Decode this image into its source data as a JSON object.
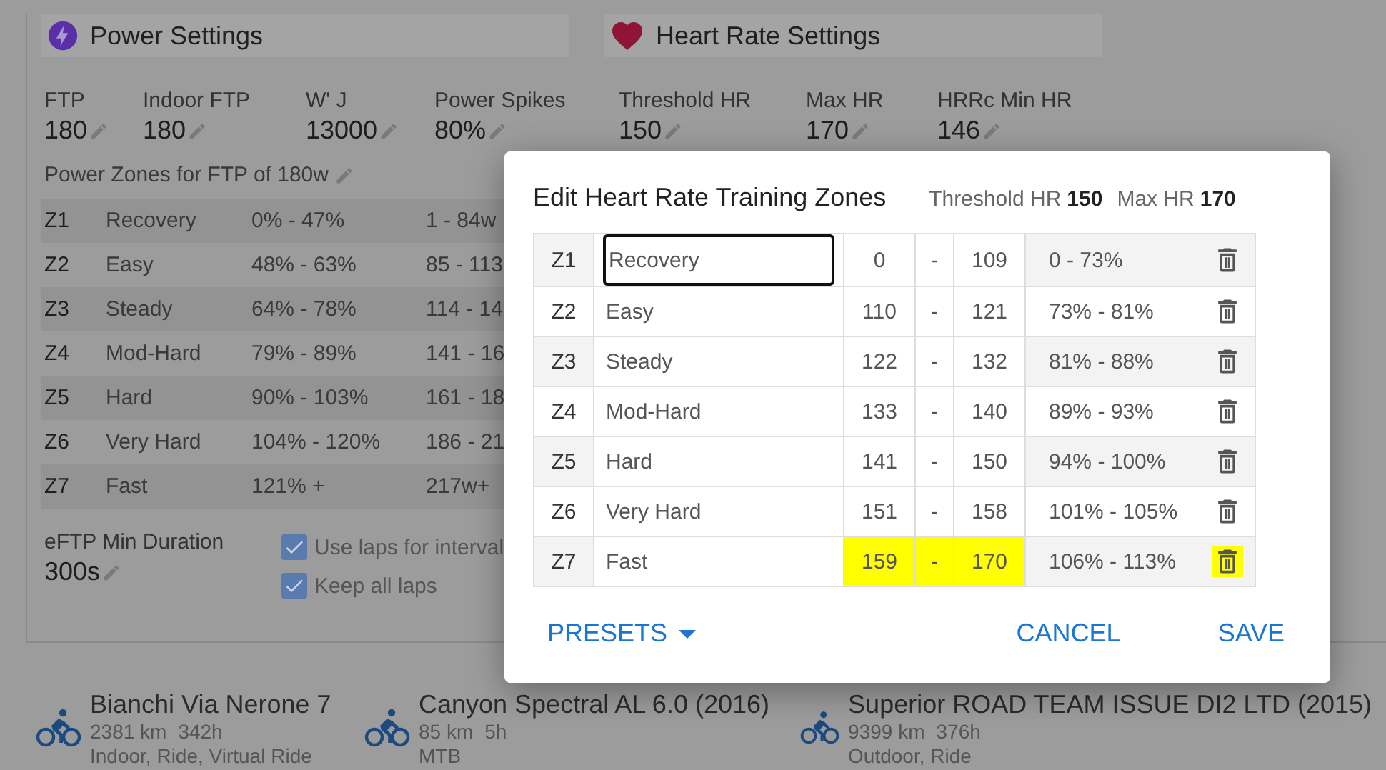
{
  "power_settings": {
    "title": "Power Settings",
    "fields": [
      {
        "label": "FTP",
        "value": "180"
      },
      {
        "label": "Indoor FTP",
        "value": "180"
      },
      {
        "label": "W' J",
        "value": "13000"
      },
      {
        "label": "Power Spikes",
        "value": "80%"
      }
    ],
    "zones_title": "Power Zones for FTP of 180w",
    "zones": [
      {
        "zone": "Z1",
        "name": "Recovery",
        "percent": "0% - 47%",
        "watts": "1 - 84w"
      },
      {
        "zone": "Z2",
        "name": "Easy",
        "percent": "48% - 63%",
        "watts": "85 - 113"
      },
      {
        "zone": "Z3",
        "name": "Steady",
        "percent": "64% - 78%",
        "watts": "114 - 14"
      },
      {
        "zone": "Z4",
        "name": "Mod-Hard",
        "percent": "79% - 89%",
        "watts": "141 - 16"
      },
      {
        "zone": "Z5",
        "name": "Hard",
        "percent": "90% - 103%",
        "watts": "161 - 18"
      },
      {
        "zone": "Z6",
        "name": "Very Hard",
        "percent": "104% - 120%",
        "watts": "186 - 21"
      },
      {
        "zone": "Z7",
        "name": "Fast",
        "percent": "121% +",
        "watts": "217w+"
      }
    ],
    "eftp": {
      "label": "eFTP Min Duration",
      "value": "300s"
    },
    "options": [
      {
        "label": "Use laps for interval",
        "checked": true
      },
      {
        "label": "Keep all laps",
        "checked": true
      }
    ]
  },
  "heart_rate_settings": {
    "title": "Heart Rate Settings",
    "fields": [
      {
        "label": "Threshold HR",
        "value": "150"
      },
      {
        "label": "Max HR",
        "value": "170"
      },
      {
        "label": "HRRc Min HR",
        "value": "146"
      }
    ]
  },
  "bikes": [
    {
      "name": "Bianchi Via Nerone 7",
      "distance": "2381 km",
      "time": "342h",
      "types": "Indoor, Ride, Virtual Ride"
    },
    {
      "name": "Canyon Spectral AL 6.0 (2016)",
      "distance": "85 km",
      "time": "5h",
      "types": "MTB"
    },
    {
      "name": "Superior ROAD TEAM ISSUE DI2 LTD (2015)",
      "distance": "9399 km",
      "time": "376h",
      "types": "Outdoor, Ride"
    }
  ],
  "dialog": {
    "title": "Edit Heart Rate Training Zones",
    "threshold_label": "Threshold HR",
    "threshold_value": "150",
    "max_label": "Max HR",
    "max_value": "170",
    "zones": [
      {
        "zone": "Z1",
        "name": "Recovery",
        "focused": true,
        "min": "0",
        "separator": "-",
        "max": "109",
        "percent": "0 - 73%",
        "highlighted": false
      },
      {
        "zone": "Z2",
        "name": "Easy",
        "focused": false,
        "min": "110",
        "separator": "-",
        "max": "121",
        "percent": "73% - 81%",
        "highlighted": false
      },
      {
        "zone": "Z3",
        "name": "Steady",
        "focused": false,
        "min": "122",
        "separator": "-",
        "max": "132",
        "percent": "81% - 88%",
        "highlighted": false
      },
      {
        "zone": "Z4",
        "name": "Mod-Hard",
        "focused": false,
        "min": "133",
        "separator": "-",
        "max": "140",
        "percent": "89% - 93%",
        "highlighted": false
      },
      {
        "zone": "Z5",
        "name": "Hard",
        "focused": false,
        "min": "141",
        "separator": "-",
        "max": "150",
        "percent": "94% - 100%",
        "highlighted": false
      },
      {
        "zone": "Z6",
        "name": "Very Hard",
        "focused": false,
        "min": "151",
        "separator": "-",
        "max": "158",
        "percent": "101% - 105%",
        "highlighted": false
      },
      {
        "zone": "Z7",
        "name": "Fast",
        "focused": false,
        "min": "159",
        "separator": "-",
        "max": "170",
        "percent": "106% - 113%",
        "highlighted": true
      }
    ],
    "presets_button": "PRESETS",
    "cancel_button": "CANCEL",
    "save_button": "SAVE"
  }
}
